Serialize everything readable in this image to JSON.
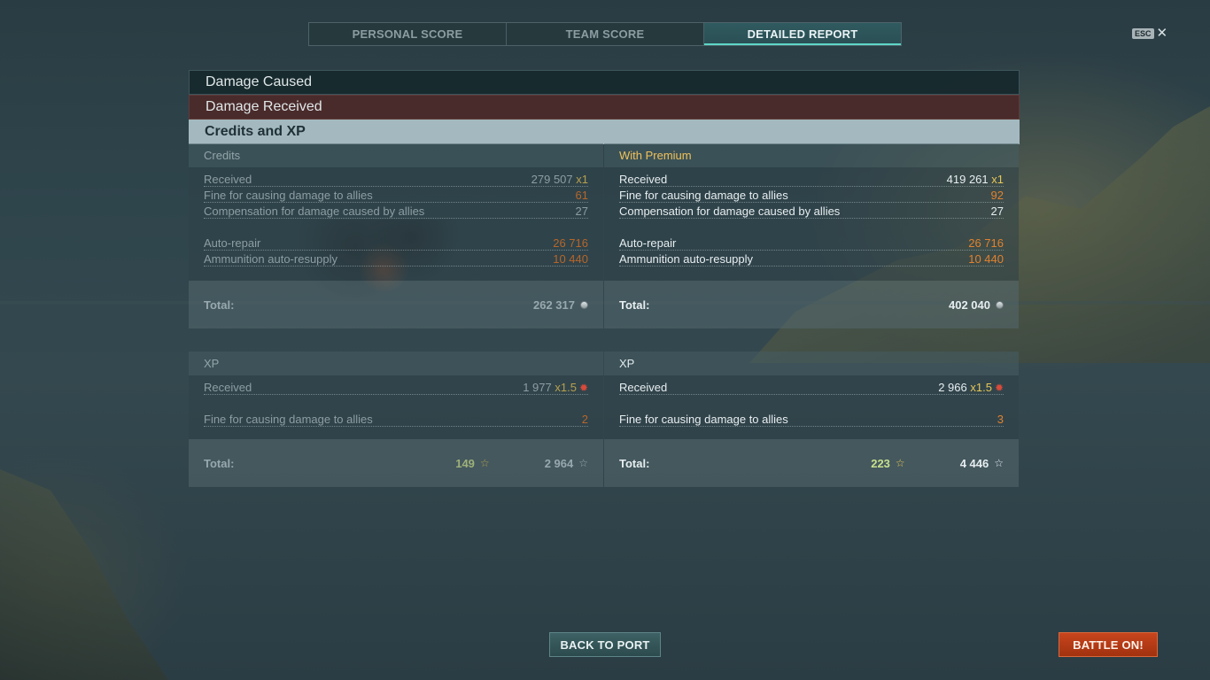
{
  "tabs": [
    {
      "label": "PERSONAL SCORE",
      "active": false
    },
    {
      "label": "TEAM SCORE",
      "active": false
    },
    {
      "label": "DETAILED REPORT",
      "active": true
    }
  ],
  "esc": {
    "key": "ESC",
    "close_icon": "close-icon"
  },
  "sections": {
    "damage_caused": "Damage Caused",
    "damage_received": "Damage Received",
    "credits_xp": "Credits and XP"
  },
  "credits": {
    "basic": {
      "header": "Credits",
      "received_label": "Received",
      "received_value": "279 507",
      "received_mult": "x1",
      "fine_label": "Fine for causing damage to allies",
      "fine_value": "61",
      "comp_label": "Compensation for damage caused by allies",
      "comp_value": "27",
      "repair_label": "Auto-repair",
      "repair_value": "26 716",
      "ammo_label": "Ammunition auto-resupply",
      "ammo_value": "10 440",
      "total_label": "Total:",
      "total_value": "262 317"
    },
    "premium": {
      "header": "With Premium",
      "received_label": "Received",
      "received_value": "419 261",
      "received_mult": "x1",
      "fine_label": "Fine for causing damage to allies",
      "fine_value": "92",
      "comp_label": "Compensation for damage caused by allies",
      "comp_value": "27",
      "repair_label": "Auto-repair",
      "repair_value": "26 716",
      "ammo_label": "Ammunition auto-resupply",
      "ammo_value": "10 440",
      "total_label": "Total:",
      "total_value": "402 040"
    }
  },
  "xp": {
    "basic": {
      "header": "XP",
      "received_label": "Received",
      "received_value": "1 977",
      "received_mult": "x1.5",
      "fine_label": "Fine for causing damage to allies",
      "fine_value": "2",
      "total_label": "Total:",
      "free_xp": "149",
      "total_value": "2 964"
    },
    "premium": {
      "header": "XP",
      "received_label": "Received",
      "received_value": "2 966",
      "received_mult": "x1.5",
      "fine_label": "Fine for causing damage to allies",
      "fine_value": "3",
      "total_label": "Total:",
      "free_xp": "223",
      "total_value": "4 446"
    }
  },
  "buttons": {
    "back_to_port": "BACK TO PORT",
    "battle_on": "BATTLE ON!"
  },
  "colors": {
    "accent_tab": "#5fd6c7",
    "penalty_orange": "#e0822e",
    "multiplier_yellow": "#e6c757",
    "premium_gold": "#f0c15a",
    "free_xp_green": "#c8e08c",
    "battle_button": "#c7451d"
  },
  "icons": {
    "credits": "coin-icon",
    "xp": "star-icon",
    "xp_multiplier": "xp-multiplier-icon"
  }
}
